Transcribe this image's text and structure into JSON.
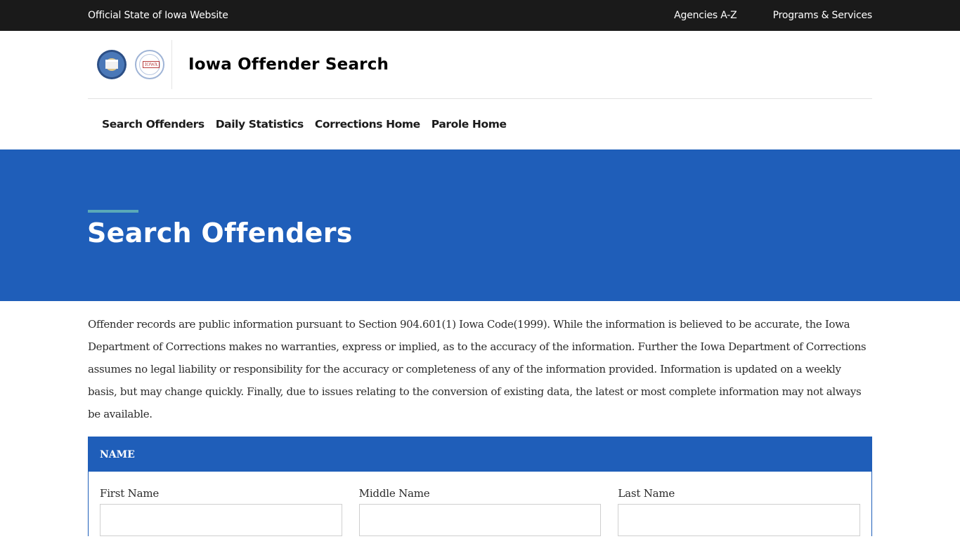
{
  "topbar": {
    "official_label": "Official State of Iowa Website",
    "links": [
      "Agencies A-Z",
      "Programs & Services"
    ]
  },
  "header": {
    "logos": [
      "department-of-corrections-seal",
      "board-of-parole-seal"
    ],
    "site_title": "Iowa Offender Search"
  },
  "nav": {
    "items": [
      "Search Offenders",
      "Daily Statistics",
      "Corrections Home",
      "Parole Home"
    ]
  },
  "hero": {
    "title": "Search Offenders"
  },
  "disclaimer": "Offender records are public information pursuant to Section 904.601(1) Iowa Code(1999). While the information is believed to be accurate, the Iowa Department of Corrections makes no warranties, express or implied, as to the accuracy of the information. Further the Iowa Department of Corrections assumes no legal liability or responsibility for the accuracy or completeness of any of the information provided. Information is updated on a weekly basis, but may change quickly. Finally, due to issues relating to the conversion of existing data, the latest or most complete information may not always be available.",
  "name_panel": {
    "heading": "NAME",
    "fields": [
      {
        "label": "First Name",
        "value": ""
      },
      {
        "label": "Middle Name",
        "value": ""
      },
      {
        "label": "Last Name",
        "value": ""
      }
    ]
  },
  "colors": {
    "topbar_bg": "#1a1a1a",
    "brand_blue": "#1f5eb9",
    "accent_teal": "#5aa9b8"
  }
}
